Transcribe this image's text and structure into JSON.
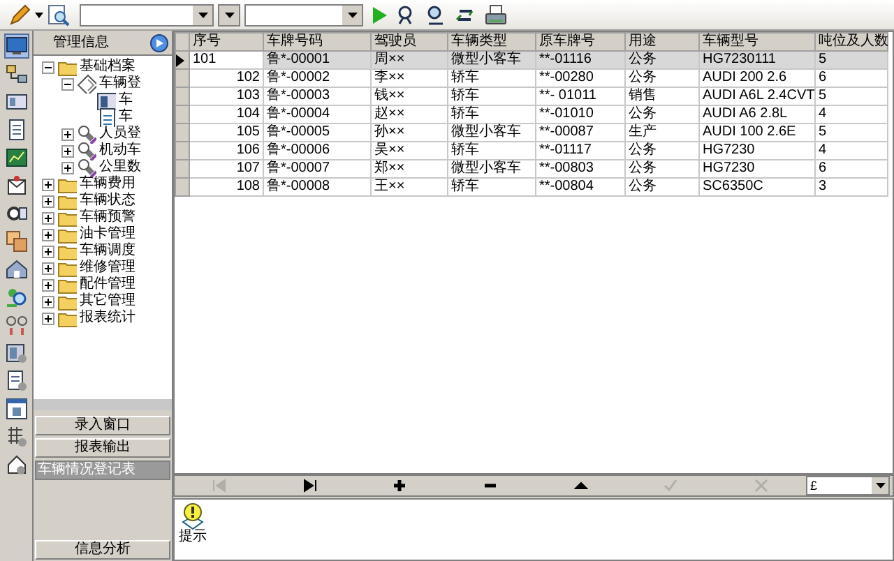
{
  "sidebar": {
    "items": [
      {
        "selected": true
      },
      {
        "selected": false
      },
      {
        "selected": false
      },
      {
        "selected": false
      },
      {
        "selected": false
      },
      {
        "selected": false
      },
      {
        "selected": false
      },
      {
        "selected": false
      },
      {
        "selected": false
      },
      {
        "selected": false
      },
      {
        "selected": false
      },
      {
        "selected": false
      },
      {
        "selected": false
      },
      {
        "selected": false
      },
      {
        "selected": false
      },
      {
        "selected": false
      }
    ]
  },
  "panel": {
    "title": "管理信息"
  },
  "tree": [
    {
      "label": "基础档案",
      "kind": "folder",
      "expanded": true,
      "children": [
        {
          "label": "车辆登",
          "kind": "diamond",
          "expanded": true,
          "children": [
            {
              "label": "车",
              "kind": "form"
            },
            {
              "label": "车",
              "kind": "doc"
            }
          ]
        },
        {
          "label": "人员登",
          "kind": "tool",
          "expanded": false
        },
        {
          "label": "机动车",
          "kind": "tool",
          "expanded": false
        },
        {
          "label": "公里数",
          "kind": "tool",
          "expanded": false
        }
      ]
    },
    {
      "label": "车辆费用",
      "kind": "folder",
      "expanded": false
    },
    {
      "label": "车辆状态",
      "kind": "folder",
      "expanded": false
    },
    {
      "label": "车辆预警",
      "kind": "folder",
      "expanded": false
    },
    {
      "label": "油卡管理",
      "kind": "folder",
      "expanded": false
    },
    {
      "label": "车辆调度",
      "kind": "folder",
      "expanded": false
    },
    {
      "label": "维修管理",
      "kind": "folder",
      "expanded": false
    },
    {
      "label": "配件管理",
      "kind": "folder",
      "expanded": false
    },
    {
      "label": "其它管理",
      "kind": "folder",
      "expanded": false
    },
    {
      "label": "报表统计",
      "kind": "folder",
      "expanded": false
    }
  ],
  "panel_buttons": [
    {
      "label": "录入窗口",
      "selected": false
    },
    {
      "label": "报表输出",
      "selected": false
    },
    {
      "label": "车辆情况登记表",
      "selected": true
    }
  ],
  "bottom_button": "信息分析",
  "table": {
    "columns": [
      "序号",
      "车牌号码",
      "驾驶员",
      "车辆类型",
      "原车牌号",
      "用途",
      "车辆型号",
      "吨位及人数"
    ],
    "rows": [
      {
        "selected": true,
        "cells": [
          "101",
          "鲁*-00001",
          "周××",
          "微型小客车",
          "**-01116",
          "公务",
          "HG7230111",
          "5"
        ]
      },
      {
        "selected": false,
        "cells": [
          "102",
          "鲁*-00002",
          "李××",
          "轿车",
          "**-00280",
          "公务",
          "AUDI 200 2.6",
          "6"
        ]
      },
      {
        "selected": false,
        "cells": [
          "103",
          "鲁*-00003",
          "钱××",
          "轿车",
          "**- 01011",
          "销售",
          "AUDI A6L 2.4CVT",
          "5"
        ]
      },
      {
        "selected": false,
        "cells": [
          "104",
          "鲁*-00004",
          "赵××",
          "轿车",
          "**-01010",
          "公务",
          "AUDI A6 2.8L",
          "4"
        ]
      },
      {
        "selected": false,
        "cells": [
          "105",
          "鲁*-00005",
          "孙××",
          "微型小客车",
          "**-00087",
          "生产",
          "AUDI 100 2.6E",
          "5"
        ]
      },
      {
        "selected": false,
        "cells": [
          "106",
          "鲁*-00006",
          "吴××",
          "轿车",
          "**-01117",
          "公务",
          "HG7230",
          "4"
        ]
      },
      {
        "selected": false,
        "cells": [
          "107",
          "鲁*-00007",
          "郑××",
          "微型小客车",
          "**-00803",
          "公务",
          "HG7230",
          "6"
        ]
      },
      {
        "selected": false,
        "cells": [
          "108",
          "鲁*-00008",
          "王××",
          "轿车",
          "**-00804",
          "公务",
          "SC6350C",
          "3"
        ]
      }
    ]
  },
  "navigator": {
    "buttons": [
      {
        "kind": "first",
        "disabled": true
      },
      {
        "kind": "last",
        "disabled": false
      },
      {
        "kind": "add",
        "disabled": false
      },
      {
        "kind": "delete",
        "disabled": false
      },
      {
        "kind": "up",
        "disabled": false
      },
      {
        "kind": "post",
        "disabled": true
      },
      {
        "kind": "cancel",
        "disabled": true
      }
    ],
    "combo": {
      "value": "£"
    }
  },
  "tip": {
    "label": "提示"
  }
}
